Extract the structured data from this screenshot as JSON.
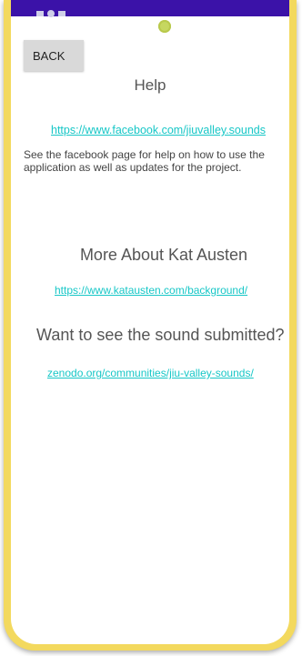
{
  "status_bar": {
    "icons": [
      "status-square-icon",
      "status-circle-icon",
      "status-square-icon"
    ]
  },
  "toolbar": {
    "back_label": "BACK"
  },
  "help": {
    "title": "Help",
    "facebook_link": "https://www.facebook.com/jiuvalley.sounds",
    "description": "See the facebook page for help on how to use the application as well as updates for the project."
  },
  "about": {
    "title": "More About Kat Austen",
    "link": "https://www.katausten.com/background/"
  },
  "submitted": {
    "title": "Want to see the sound submitted?",
    "link": "zenodo.org/communities/jiu-valley-sounds/"
  },
  "colors": {
    "frame": "#f3d95e",
    "status_bar": "#3b12a8",
    "link": "#17c7c7",
    "camera": "#c6d760"
  }
}
